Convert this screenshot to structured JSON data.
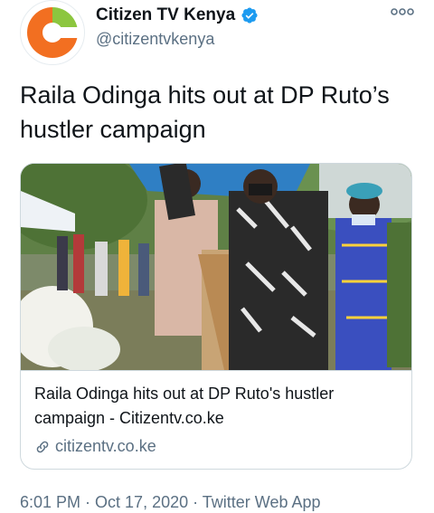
{
  "account": {
    "display_name": "Citizen TV Kenya",
    "handle": "@citizentvkenya",
    "verified": true,
    "avatar_icon": "citizen-tv-logo",
    "brand_colors": {
      "orange": "#f26f21",
      "green": "#8cc63f"
    }
  },
  "tweet": {
    "text": "Raila Odinga hits out at DP Ruto’s hustler campaign"
  },
  "card": {
    "title": "Raila Odinga hits out at DP Ruto's hustler campaign - Citizentv.co.ke",
    "domain": "citizentv.co.ke",
    "link_icon": "link-icon"
  },
  "meta": {
    "time": "6:01 PM",
    "date": "Oct 17, 2020",
    "source": "Twitter Web App",
    "separator": " · "
  },
  "colors": {
    "text_primary": "#0f1419",
    "text_secondary": "#5b7083",
    "border": "#cfd9de",
    "verified_blue": "#1d9bf0"
  }
}
